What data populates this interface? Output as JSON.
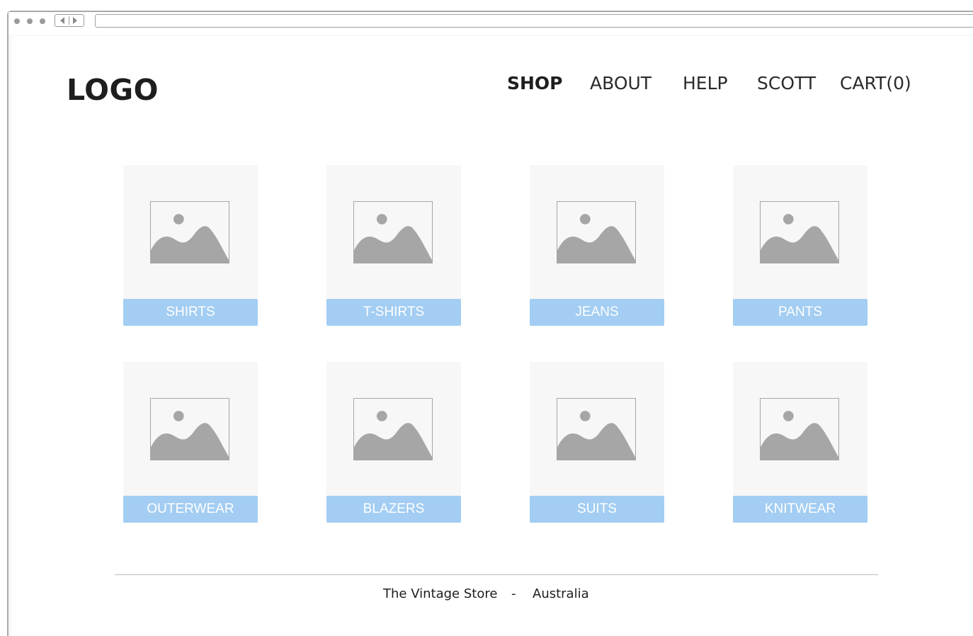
{
  "header": {
    "logo": "LOGO",
    "nav": [
      "SHOP",
      "ABOUT",
      "HELP",
      "SCOTT",
      "CART(0)"
    ],
    "active_nav": "SHOP"
  },
  "categories": [
    {
      "label": "SHIRTS",
      "icon": "image-placeholder-icon"
    },
    {
      "label": "T-SHIRTS",
      "icon": "image-placeholder-icon"
    },
    {
      "label": "JEANS",
      "icon": "image-placeholder-icon"
    },
    {
      "label": "PANTS",
      "icon": "image-placeholder-icon"
    },
    {
      "label": "OUTERWEAR",
      "icon": "image-placeholder-icon"
    },
    {
      "label": "BLAZERS",
      "icon": "image-placeholder-icon"
    },
    {
      "label": "SUITS",
      "icon": "image-placeholder-icon"
    },
    {
      "label": "KNITWEAR",
      "icon": "image-placeholder-icon"
    }
  ],
  "footer": {
    "store": "The Vintage Store",
    "separator": "-",
    "country": "Australia"
  },
  "colors": {
    "label_bg": "#a3cdf2",
    "tile_bg": "#f7f7f7",
    "placeholder_grey": "#a6a6a6"
  }
}
